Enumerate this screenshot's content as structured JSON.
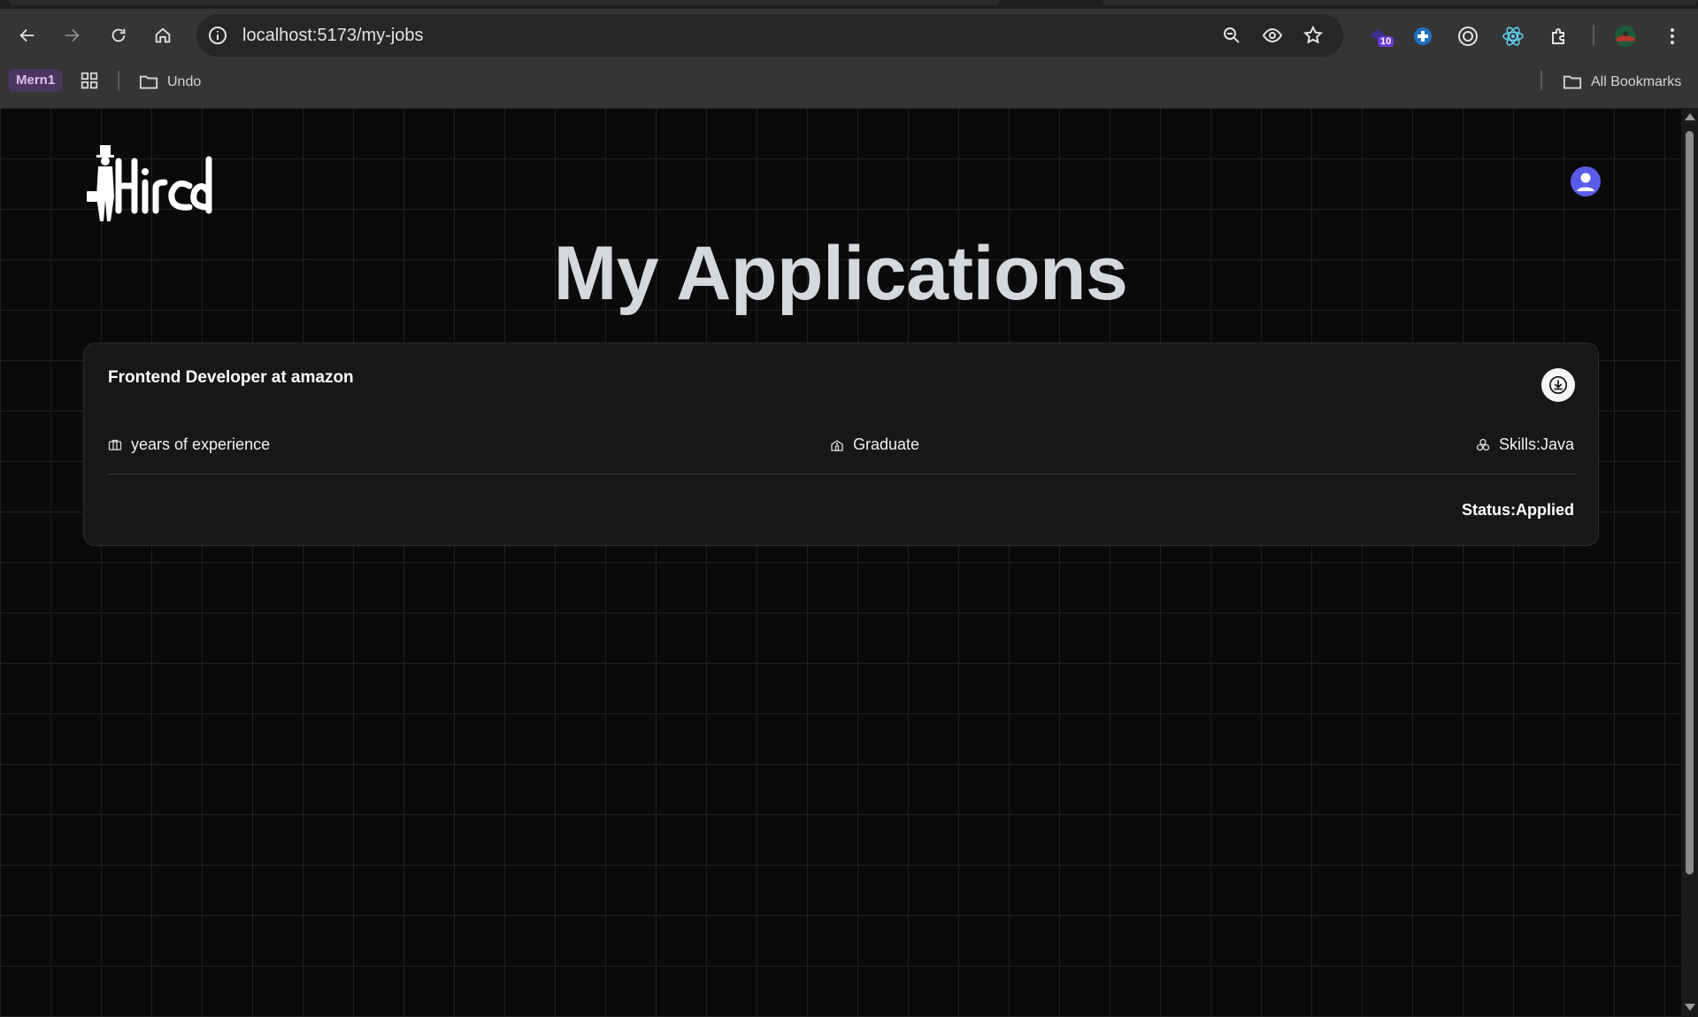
{
  "browser": {
    "url": "localhost:5173/my-jobs",
    "extension_badge": "10",
    "bookmarks": {
      "tag_label": "Mern1",
      "folder_label": "Undo",
      "all_bookmarks_label": "All Bookmarks"
    },
    "icons": [
      "back-icon",
      "forward-icon",
      "reload-icon",
      "home-icon",
      "site-info-icon",
      "zoom-icon",
      "eye-icon",
      "star-icon",
      "extension-puzzle-icon",
      "profile-icon",
      "menu-dots-icon",
      "apps-grid-icon",
      "folder-icon"
    ]
  },
  "app": {
    "logo_text": "Hired",
    "page_title": "My Applications",
    "applications": [
      {
        "title": "Frontend Developer at amazon",
        "experience": "years of experience",
        "education": "Graduate",
        "skills": "Skills:Java",
        "status": "Status:Applied"
      }
    ]
  },
  "colors": {
    "page_bg": "#0a0a0a",
    "card_bg": "#171717",
    "title_text": "#d5d8dc",
    "avatar": "#5b5bea",
    "bookmark_tag": "#4a3760"
  }
}
